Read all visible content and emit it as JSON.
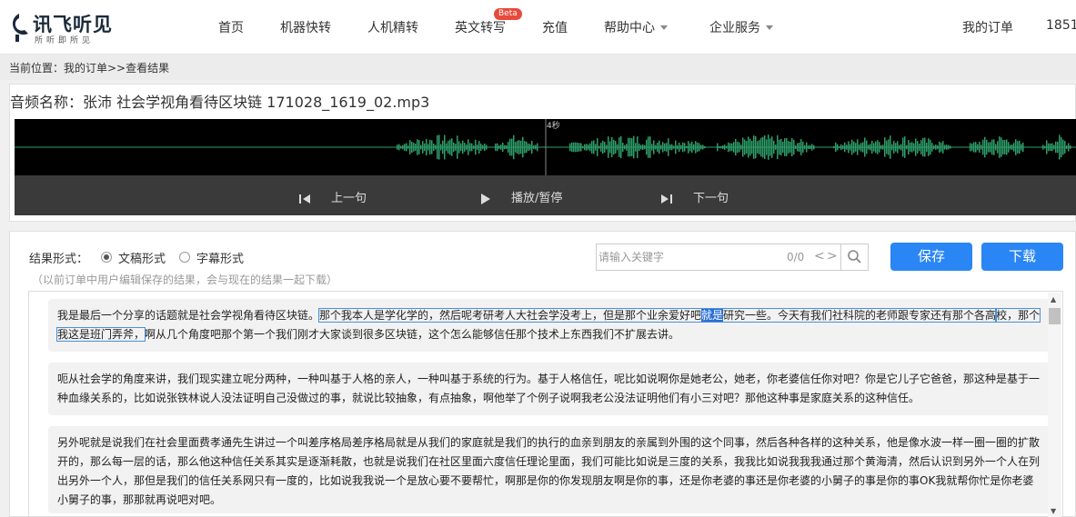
{
  "nav": {
    "logo_main": "讯飞听见",
    "logo_sub": "所听即所见",
    "items": [
      "首页",
      "机器快转",
      "人机精转",
      "英文转写",
      "充值",
      "帮助中心",
      "企业服务"
    ],
    "beta_badge": "Beta",
    "my_orders": "我的订单",
    "phone_partial": "1851"
  },
  "breadcrumb": "当前位置：我的订单>>查看结果",
  "audio": {
    "title": "音频名称：张沛 社会学视角看待区块链 171028_1619_02.mp3",
    "time_marker": "4秒",
    "controls": {
      "prev": "上一句",
      "play": "播放/暂停",
      "next": "下一句"
    }
  },
  "result": {
    "form_label": "结果形式：",
    "options": [
      "文稿形式",
      "字幕形式"
    ],
    "selected": "文稿形式",
    "note": "（以前订单中用户编辑保存的结果，会与现在的结果一起下载）",
    "search_placeholder": "请输入关键字",
    "search_count": "0/0",
    "prev_match": "<",
    "next_match": ">",
    "save": "保存",
    "download": "下载"
  },
  "transcript": {
    "p1_a": "我是最后一个分享的话题就是社会学视角看待区块链。",
    "p1_b": "那个我本人是学化学的，然后呢考研考人大社会学没考上，但是那个业余爱好吧",
    "p1_c": "就是",
    "p1_d": "研究一些。今天有我们社科院的老师跟专家还有那个各高",
    "p1_e": "校，那个我这是班门弄斧，",
    "p1_f": "啊从几个角度吧那个第一个我们刚才大家谈到很多区块链，这个怎么能够信任那个技术上东西我们不扩展去讲。",
    "p2": "呃从社会学的角度来讲，我们现实建立呢分两种，一种叫基于人格的亲人，一种叫基于系统的行为。基于人格信任，呢比如说啊你是她老公，她老，你老婆信任你对吧？你是它儿子它爸爸，那这种是基于一种血缘关系的，比如说张铁林说人没法证明自己没做过的事，就说比较抽象，有点抽象，啊他举了个例子说啊我老公没法证明他们有小三对吧？那他这种事是家庭关系的这种信任。",
    "p3": "另外呢就是说我们在社会里面费孝通先生讲过一个叫差序格局差序格局就是从我们的家庭就是我们的执行的血亲到朋友的亲属到外围的这个同事，然后各种各样的这种关系，他是像水波一样一圈一圈的扩散开的，那么每一层的话，那么他这种信任关系其实是逐渐耗散，也就是说我们在社区里面六度信任理论里面，我们可能比如说是三度的关系，我我比如说我我我通过那个黄海清，然后认识到另外一个人在列出另外一个人，那但是我们的信任关系网只有一度的，比如说我我说一个是放心要不要帮忙，啊那是你的你发现朋友啊是你的事，还是你老婆的事还是你老婆的小舅子的事是你的事OK我就帮你忙是你老婆小舅子的事，那那就再说吧对吧。"
  },
  "colors": {
    "accent": "#2a86f4",
    "wave": "#2e9e6a",
    "highlight": "#2a6fd6"
  }
}
